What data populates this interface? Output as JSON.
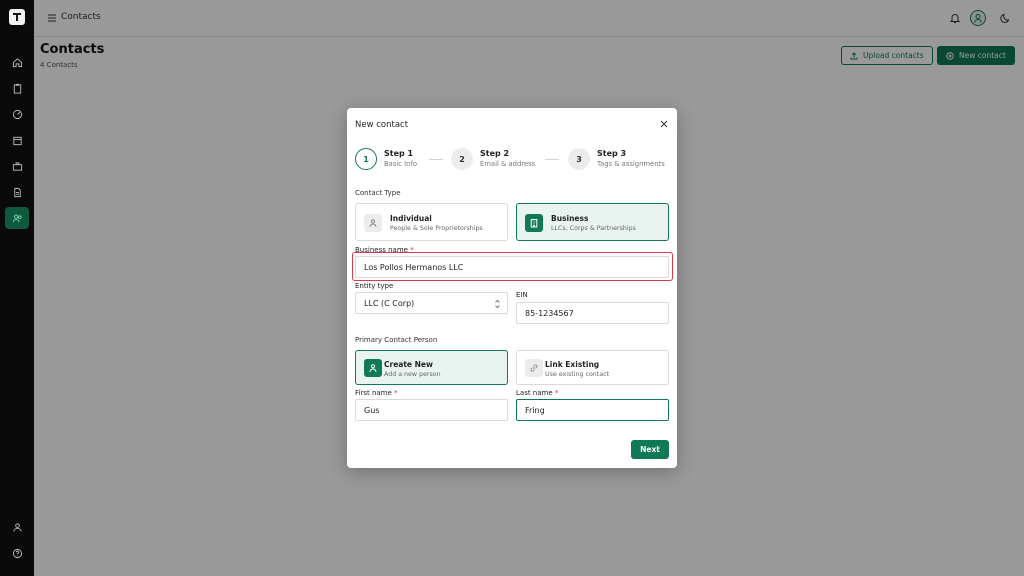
{
  "topbar": {
    "title": "Contacts"
  },
  "header": {
    "title": "Contacts",
    "subtitle": "4 Contacts",
    "upload_label": "Upload contacts",
    "new_label": "New contact"
  },
  "modal": {
    "title": "New contact",
    "steps": [
      {
        "number": "1",
        "label": "Step 1",
        "sub": "Basic Info"
      },
      {
        "number": "2",
        "label": "Step 2",
        "sub": "Email & address"
      },
      {
        "number": "3",
        "label": "Step 3",
        "sub": "Tags & assignments"
      }
    ],
    "contact_type_label": "Contact Type",
    "contact_types": [
      {
        "title": "Individual",
        "sub": "People & Sole Proprietorships",
        "icon": "person-icon"
      },
      {
        "title": "Business",
        "sub": "LLCs, Corps & Partnerships",
        "icon": "building-icon"
      }
    ],
    "business_name": {
      "label": "Business name",
      "required": "*",
      "value": "Los Pollos Hermanos LLC"
    },
    "entity_type": {
      "label": "Entity type",
      "value": "LLC (C Corp)"
    },
    "ein": {
      "label": "EIN",
      "value": "85-1234567"
    },
    "primary_contact_label": "Primary Contact Person",
    "primary_options": [
      {
        "title": "Create New",
        "sub": "Add a new person",
        "icon": "person-icon"
      },
      {
        "title": "Link Existing",
        "sub": "Use existing contact",
        "icon": "link-icon"
      }
    ],
    "first_name": {
      "label": "First name",
      "required": "*",
      "value": "Gus"
    },
    "last_name": {
      "label": "Last name",
      "required": "*",
      "value": "Fring"
    },
    "next_label": "Next"
  },
  "colors": {
    "accent": "#0f7a55",
    "highlight": "#d33a4a"
  }
}
